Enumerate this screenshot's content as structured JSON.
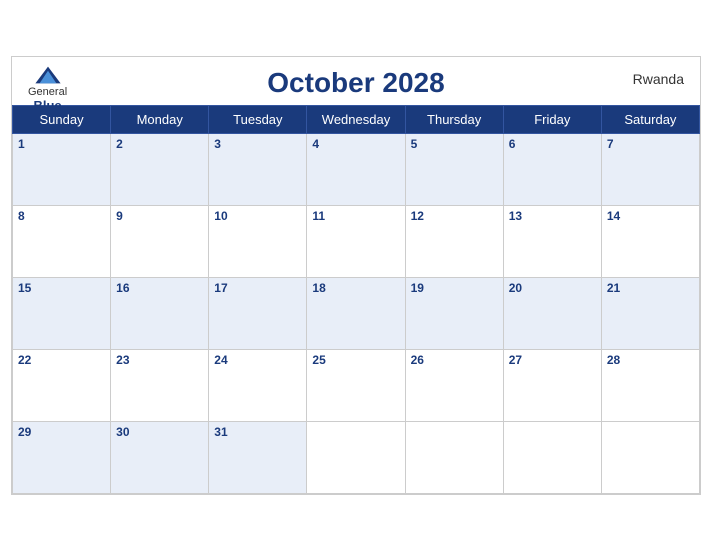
{
  "header": {
    "logo": {
      "general": "General",
      "blue": "Blue",
      "icon": "▲"
    },
    "title": "October 2028",
    "country": "Rwanda"
  },
  "weekdays": [
    "Sunday",
    "Monday",
    "Tuesday",
    "Wednesday",
    "Thursday",
    "Friday",
    "Saturday"
  ],
  "weeks": [
    [
      {
        "day": 1,
        "active": true
      },
      {
        "day": 2,
        "active": true
      },
      {
        "day": 3,
        "active": true
      },
      {
        "day": 4,
        "active": true
      },
      {
        "day": 5,
        "active": true
      },
      {
        "day": 6,
        "active": true
      },
      {
        "day": 7,
        "active": true
      }
    ],
    [
      {
        "day": 8,
        "active": true
      },
      {
        "day": 9,
        "active": true
      },
      {
        "day": 10,
        "active": true
      },
      {
        "day": 11,
        "active": true
      },
      {
        "day": 12,
        "active": true
      },
      {
        "day": 13,
        "active": true
      },
      {
        "day": 14,
        "active": true
      }
    ],
    [
      {
        "day": 15,
        "active": true
      },
      {
        "day": 16,
        "active": true
      },
      {
        "day": 17,
        "active": true
      },
      {
        "day": 18,
        "active": true
      },
      {
        "day": 19,
        "active": true
      },
      {
        "day": 20,
        "active": true
      },
      {
        "day": 21,
        "active": true
      }
    ],
    [
      {
        "day": 22,
        "active": true
      },
      {
        "day": 23,
        "active": true
      },
      {
        "day": 24,
        "active": true
      },
      {
        "day": 25,
        "active": true
      },
      {
        "day": 26,
        "active": true
      },
      {
        "day": 27,
        "active": true
      },
      {
        "day": 28,
        "active": true
      }
    ],
    [
      {
        "day": 29,
        "active": true
      },
      {
        "day": 30,
        "active": true
      },
      {
        "day": 31,
        "active": true
      },
      {
        "day": null,
        "active": false
      },
      {
        "day": null,
        "active": false
      },
      {
        "day": null,
        "active": false
      },
      {
        "day": null,
        "active": false
      }
    ]
  ]
}
